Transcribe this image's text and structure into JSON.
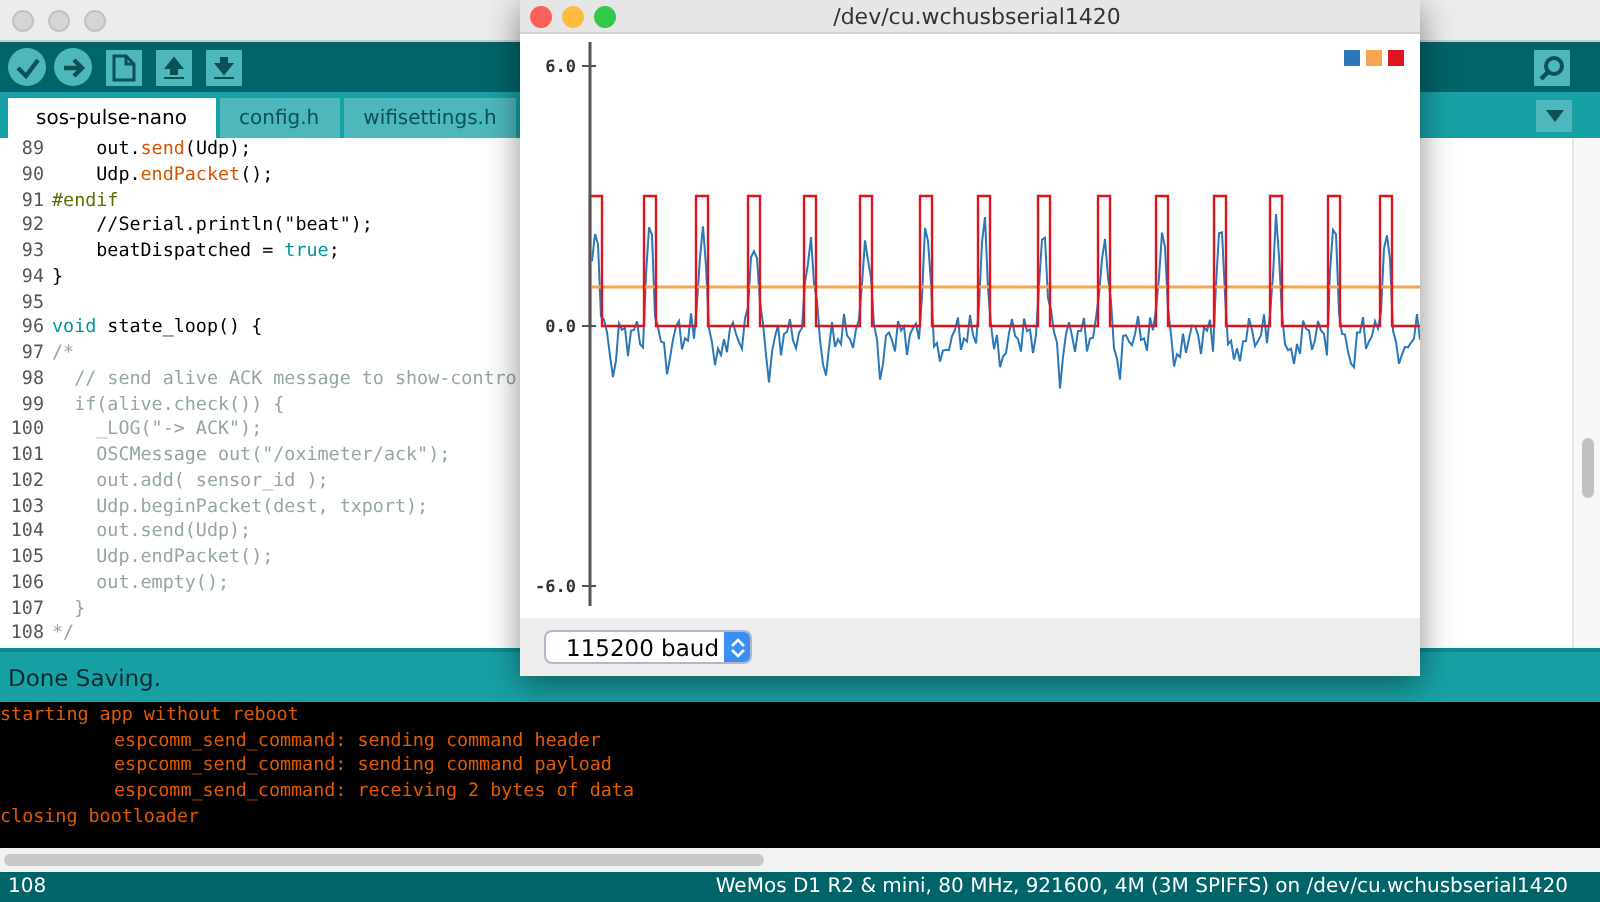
{
  "editor_window": {
    "tabs": [
      {
        "label": "sos-pulse-nano",
        "selected": true
      },
      {
        "label": "config.h",
        "selected": false
      },
      {
        "label": "wifisettings.h",
        "selected": false
      }
    ],
    "code_lines": [
      {
        "number": "89",
        "tokens": [
          {
            "text": "    out.",
            "kind": "plain"
          },
          {
            "text": "send",
            "kind": "function"
          },
          {
            "text": "(Udp);",
            "kind": "plain"
          }
        ]
      },
      {
        "number": "90",
        "tokens": [
          {
            "text": "    Udp.",
            "kind": "plain"
          },
          {
            "text": "endPacket",
            "kind": "function"
          },
          {
            "text": "();",
            "kind": "plain"
          }
        ]
      },
      {
        "number": "91",
        "tokens": [
          {
            "text": "#endif",
            "kind": "preprocessor"
          }
        ]
      },
      {
        "number": "92",
        "tokens": [
          {
            "text": "    //Serial.println(\"beat\");",
            "kind": "plain"
          }
        ]
      },
      {
        "number": "93",
        "tokens": [
          {
            "text": "    beatDispatched = ",
            "kind": "plain"
          },
          {
            "text": "true",
            "kind": "keyword"
          },
          {
            "text": ";",
            "kind": "plain"
          }
        ]
      },
      {
        "number": "94",
        "tokens": [
          {
            "text": "}",
            "kind": "plain"
          }
        ]
      },
      {
        "number": "95"
      },
      {
        "number": "96",
        "tokens": [
          {
            "text": "void",
            "kind": "keyword"
          },
          {
            "text": " state_loop() {",
            "kind": "plain"
          }
        ]
      },
      {
        "number": "97",
        "tokens": [
          {
            "text": "/*",
            "kind": "comment"
          }
        ]
      },
      {
        "number": "98",
        "tokens": [
          {
            "text": "  // send alive ACK message to show-contro",
            "kind": "comment"
          }
        ]
      },
      {
        "number": "99",
        "tokens": [
          {
            "text": "  if(alive.check()) {",
            "kind": "comment"
          }
        ]
      },
      {
        "number": "100",
        "tokens": [
          {
            "text": "    _LOG(\"-> ACK\");",
            "kind": "comment"
          }
        ]
      },
      {
        "number": "101",
        "tokens": [
          {
            "text": "    OSCMessage out(\"/oximeter/ack\");",
            "kind": "comment"
          }
        ]
      },
      {
        "number": "102",
        "tokens": [
          {
            "text": "    out.add( sensor_id );",
            "kind": "comment"
          }
        ]
      },
      {
        "number": "103",
        "tokens": [
          {
            "text": "    Udp.beginPacket(dest, txport);",
            "kind": "comment"
          }
        ]
      },
      {
        "number": "104",
        "tokens": [
          {
            "text": "    out.send(Udp);",
            "kind": "comment"
          }
        ]
      },
      {
        "number": "105",
        "tokens": [
          {
            "text": "    Udp.endPacket();",
            "kind": "comment"
          }
        ]
      },
      {
        "number": "106",
        "tokens": [
          {
            "text": "    out.empty();",
            "kind": "comment"
          }
        ]
      },
      {
        "number": "107",
        "tokens": [
          {
            "text": "  }",
            "kind": "comment"
          }
        ]
      },
      {
        "number": "108",
        "tokens": [
          {
            "text": "*/",
            "kind": "comment"
          }
        ]
      }
    ],
    "status_message": "Done Saving.",
    "console_lines": [
      {
        "text": "starting app without reboot",
        "indented": false
      },
      {
        "text": "espcomm_send_command: sending command header",
        "indented": true
      },
      {
        "text": "espcomm_send_command: sending command payload",
        "indented": true
      },
      {
        "text": "espcomm_send_command: receiving 2 bytes of data",
        "indented": true
      },
      {
        "text": "closing bootloader",
        "indented": false
      }
    ],
    "line_indicator": "108",
    "board_info": "WeMos D1 R2 & mini, 80 MHz, 921600, 4M (3M SPIFFS) on /dev/cu.wchusbserial1420"
  },
  "plotter_window": {
    "title": "/dev/cu.wchusbserial1420",
    "y_ticks": [
      "6.0",
      "0.0",
      "-6.0"
    ],
    "legend": [
      {
        "color": "#2a78b8"
      },
      {
        "color": "#f7a64f"
      },
      {
        "color": "#e0141e"
      }
    ],
    "baud": "115200 baud"
  }
}
